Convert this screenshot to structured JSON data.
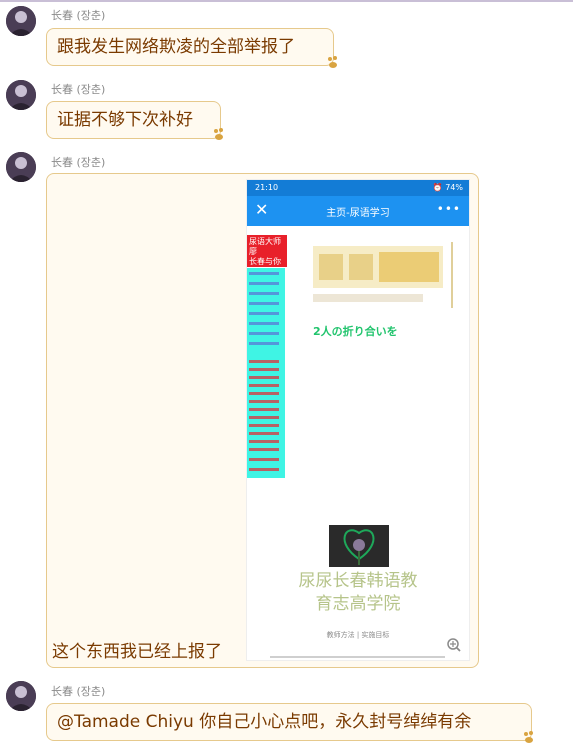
{
  "messages": [
    {
      "sender": "长春 (장춘)",
      "text": "跟我发生网络欺凌的全部举报了"
    },
    {
      "sender": "长春 (장춘)",
      "text": "证据不够下次补好"
    },
    {
      "sender": "长春 (장춘)",
      "text": "这个东西我已经上报了"
    },
    {
      "sender": "长春 (장춘)",
      "text": "@Tamade Chiyu 你自己小心点吧，永久封号绰绰有余"
    }
  ],
  "screenshot": {
    "status_time": "21:10",
    "status_right": "⏰ 74%",
    "app_title": "主页-尿语学习",
    "red_text": "尿语大师廖\n长春与你\n起学…我…",
    "green_text": "2人の折り合いを",
    "school_name_line1": "尿尿长春韩语教",
    "school_name_line2": "育志高学院",
    "footer": "教师方法 | 实施目标"
  },
  "colors": {
    "bubble_bg": "#fffaf0",
    "bubble_border": "#e6c98c",
    "bubble_text": "#7a3a00",
    "app_blue": "#1d92f1",
    "cyan": "#3ff4e4"
  }
}
